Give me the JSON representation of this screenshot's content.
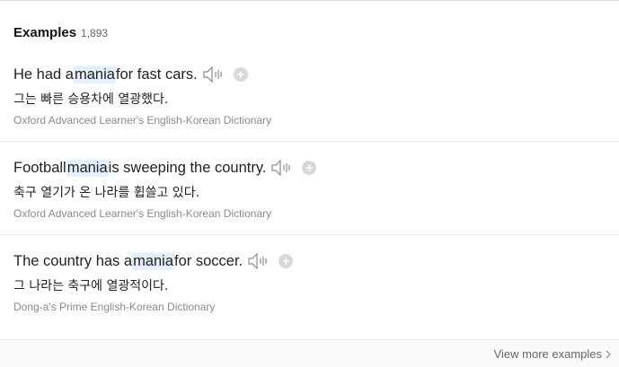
{
  "header": {
    "title": "Examples",
    "count": "1,893"
  },
  "examples": [
    {
      "before": "He had a ",
      "keyword": "mania",
      "after": " for fast cars.",
      "translation": "그는 빠른 승용차에 열광했다.",
      "source": "Oxford Advanced Learner's English-Korean Dictionary"
    },
    {
      "before": "Football ",
      "keyword": "mania",
      "after": " is sweeping the country.",
      "translation": "축구 열기가 온 나라를 휩쓸고 있다.",
      "source": "Oxford Advanced Learner's English-Korean Dictionary"
    },
    {
      "before": "The country has a ",
      "keyword": "mania",
      "after": " for soccer.",
      "translation": "그 나라는 축구에 열광적이다.",
      "source": "Dong-a's Prime English-Korean Dictionary"
    }
  ],
  "footer": {
    "view_more_label": "View more examples"
  },
  "icons": {
    "speaker": "speaker-icon",
    "add": "add-icon",
    "chevron": "chevron-right-icon"
  },
  "colors": {
    "highlight": "#e3efff",
    "source_text": "#8a8a8a",
    "add_button": "#d8d8d8"
  }
}
